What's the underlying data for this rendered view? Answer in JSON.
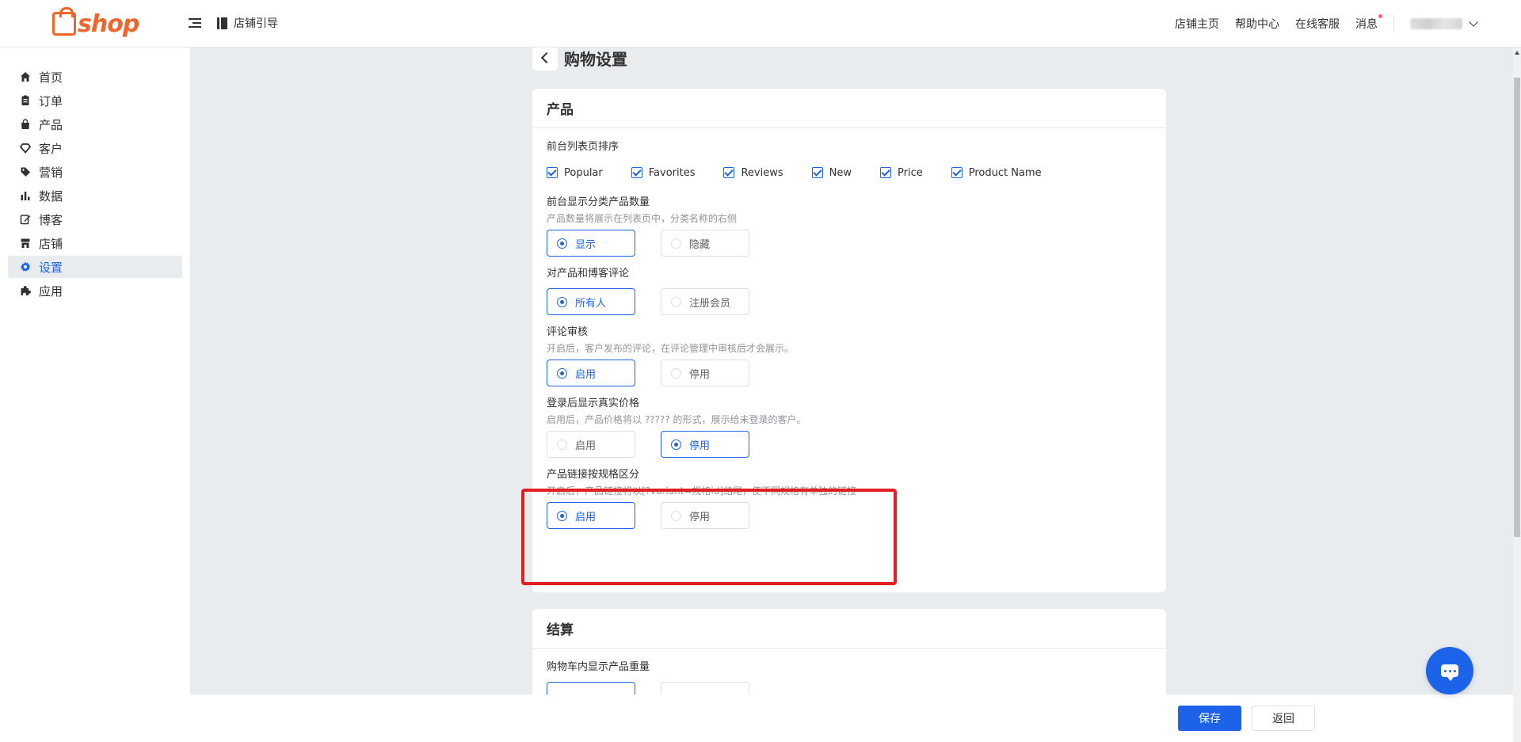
{
  "header": {
    "logo_text": "shop",
    "guide_label": "店铺引导",
    "links": [
      "店铺主页",
      "帮助中心",
      "在线客服",
      "消息"
    ]
  },
  "sidebar": {
    "items": [
      {
        "label": "首页",
        "icon": "home-icon"
      },
      {
        "label": "订单",
        "icon": "order-icon"
      },
      {
        "label": "产品",
        "icon": "bag-icon"
      },
      {
        "label": "客户",
        "icon": "diamond-icon"
      },
      {
        "label": "营销",
        "icon": "tag-icon"
      },
      {
        "label": "数据",
        "icon": "bar-chart-icon"
      },
      {
        "label": "博客",
        "icon": "edit-icon"
      },
      {
        "label": "店铺",
        "icon": "store-icon"
      },
      {
        "label": "设置",
        "icon": "gear-icon"
      },
      {
        "label": "应用",
        "icon": "puzzle-icon"
      }
    ],
    "active": "设置"
  },
  "page": {
    "title": "购物设置"
  },
  "product_card": {
    "title": "产品",
    "sort": {
      "label": "前台列表页排序",
      "options": [
        "Popular",
        "Favorites",
        "Reviews",
        "New",
        "Price",
        "Product Name"
      ]
    },
    "category_count": {
      "label": "前台显示分类产品数量",
      "desc": "产品数量将展示在列表页中，分类名称的右侧",
      "options": [
        "显示",
        "隐藏"
      ],
      "selected": "显示"
    },
    "comment": {
      "label": "对产品和博客评论",
      "options": [
        "所有人",
        "注册会员"
      ],
      "selected": "所有人"
    },
    "review": {
      "label": "评论审核",
      "desc": "开启后，客户发布的评论，在评论管理中审核后才会展示。",
      "options": [
        "启用",
        "停用"
      ],
      "selected": "启用"
    },
    "login_price": {
      "label": "登录后显示真实价格",
      "desc": "启用后，产品价格将以 ????? 的形式，展示给未登录的客户。",
      "options": [
        "启用",
        "停用"
      ],
      "selected": "停用"
    },
    "variant_link": {
      "label": "产品链接按规格区分",
      "desc": "开启后，产品链接将以[?variant=规格id]结尾，使不同规格有单独的链接",
      "options": [
        "启用",
        "停用"
      ],
      "selected": "启用"
    }
  },
  "checkout_card": {
    "title": "结算",
    "weight": {
      "label": "购物车内显示产品重量"
    }
  },
  "footer": {
    "save_label": "保存",
    "back_label": "返回"
  },
  "colors": {
    "accent": "#1c63ea",
    "brand": "#f0662a",
    "highlight": "#e02020"
  }
}
